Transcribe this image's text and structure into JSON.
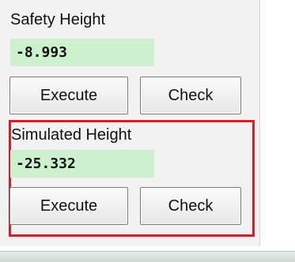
{
  "safety": {
    "label": "Safety Height",
    "value": "-8.993",
    "execute_label": "Execute",
    "check_label": "Check"
  },
  "simulated": {
    "label": "Simulated Height",
    "value": "-25.332",
    "execute_label": "Execute",
    "check_label": "Check"
  },
  "colors": {
    "value_background": "#cdf0cd",
    "highlight_border": "#d21f2a"
  }
}
